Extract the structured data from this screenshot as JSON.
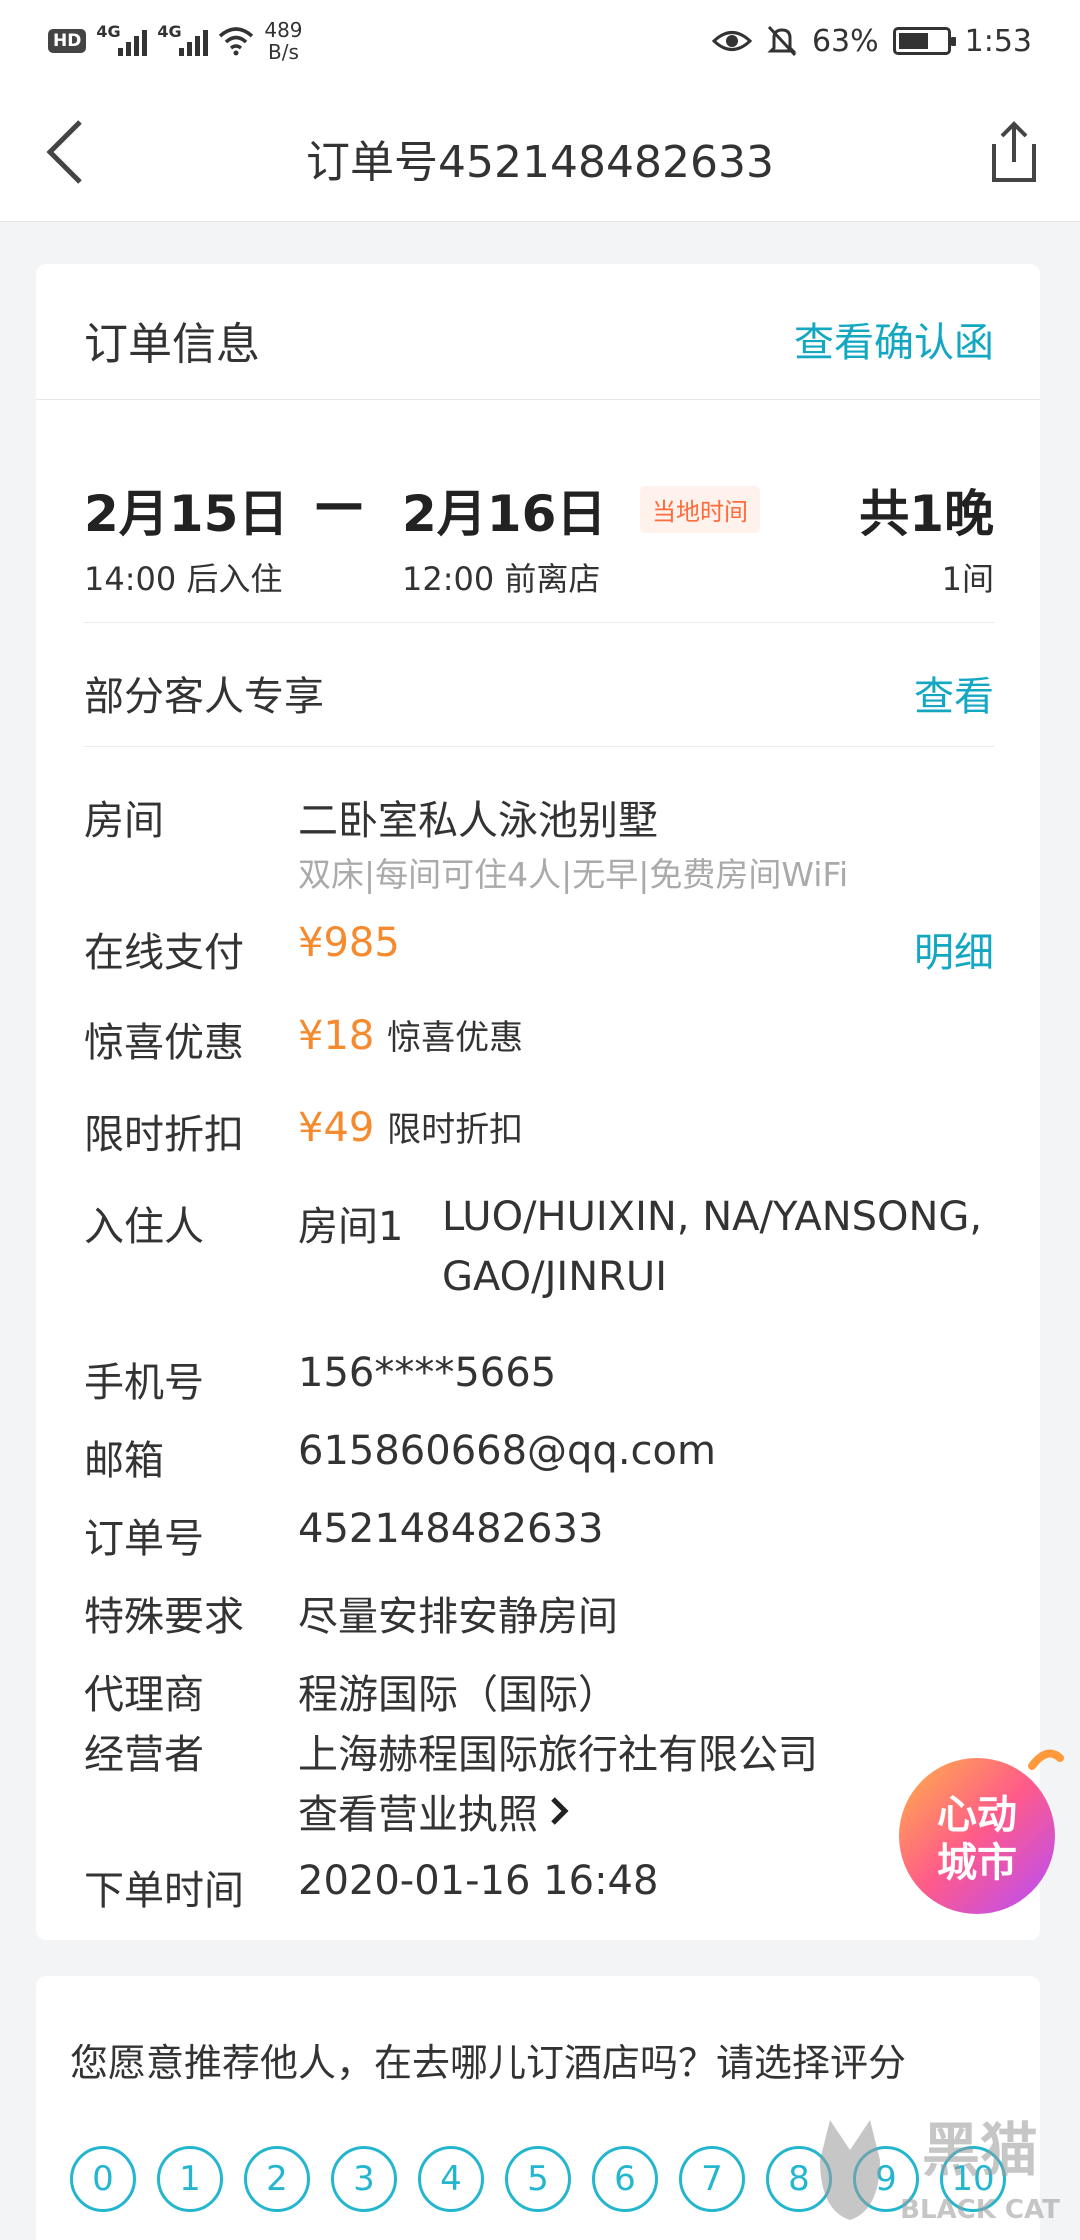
{
  "status_bar": {
    "hd": "HD",
    "net1": "4G",
    "net2": "4G",
    "speed_value": "489",
    "speed_unit": "B/s",
    "battery": "63%",
    "battery_level": 0.63,
    "time": "1:53"
  },
  "nav": {
    "title": "订单号452148482633",
    "back_icon": "back-chevron-icon",
    "share_icon": "share-icon"
  },
  "order_card": {
    "title": "订单信息",
    "confirm_link": "查看确认函",
    "checkin_date": "2月15日",
    "dash": "—",
    "checkout_date": "2月16日",
    "timezone_badge": "当地时间",
    "checkin_time": "14:00 后入住",
    "checkout_time": "12:00 前离店",
    "nights": "共1晚",
    "rooms": "1间",
    "exclusive_label": "部分客人专享",
    "exclusive_link": "查看",
    "rows": {
      "room_label": "房间",
      "room_name": "二卧室私人泳池别墅",
      "room_desc": "双床|每间可住4人|无早|免费房间WiFi",
      "pay_label": "在线支付",
      "pay_value": "¥985",
      "pay_link": "明细",
      "surprise_label": "惊喜优惠",
      "surprise_value": "¥18",
      "surprise_note": "惊喜优惠",
      "discount_label": "限时折扣",
      "discount_value": "¥49",
      "discount_note": "限时折扣",
      "guest_label": "入住人",
      "guest_room": "房间1",
      "guest_names_1": "LUO/HUIXIN, NA/YANSONG,",
      "guest_names_2": "GAO/JINRUI",
      "phone_label": "手机号",
      "phone_value": "156****5665",
      "email_label": "邮箱",
      "email_value": "615860668@qq.com",
      "order_label": "订单号",
      "order_value": "452148482633",
      "request_label": "特殊要求",
      "request_value": "尽量安排安静房间",
      "agent_label": "代理商",
      "agent_value": "程游国际（国际）",
      "operator_label": "经营者",
      "operator_value": "上海赫程国际旅行社有限公司",
      "license_link": "查看营业执照",
      "time_label": "下单时间",
      "time_value": "2020-01-16 16:48"
    },
    "promo_badge_line1": "心动",
    "promo_badge_line2": "城市"
  },
  "rating": {
    "question": "您愿意推荐他人，在去哪儿订酒店吗？请选择评分",
    "scale": [
      "0",
      "1",
      "2",
      "3",
      "4",
      "5",
      "6",
      "7",
      "8",
      "9",
      "10"
    ]
  },
  "watermark": {
    "text_cn": "黑猫",
    "text_en": "BLACK CAT"
  },
  "colors": {
    "accent": "#13a7c2",
    "price": "#f58a2e",
    "badge": "#ff6b3a"
  }
}
